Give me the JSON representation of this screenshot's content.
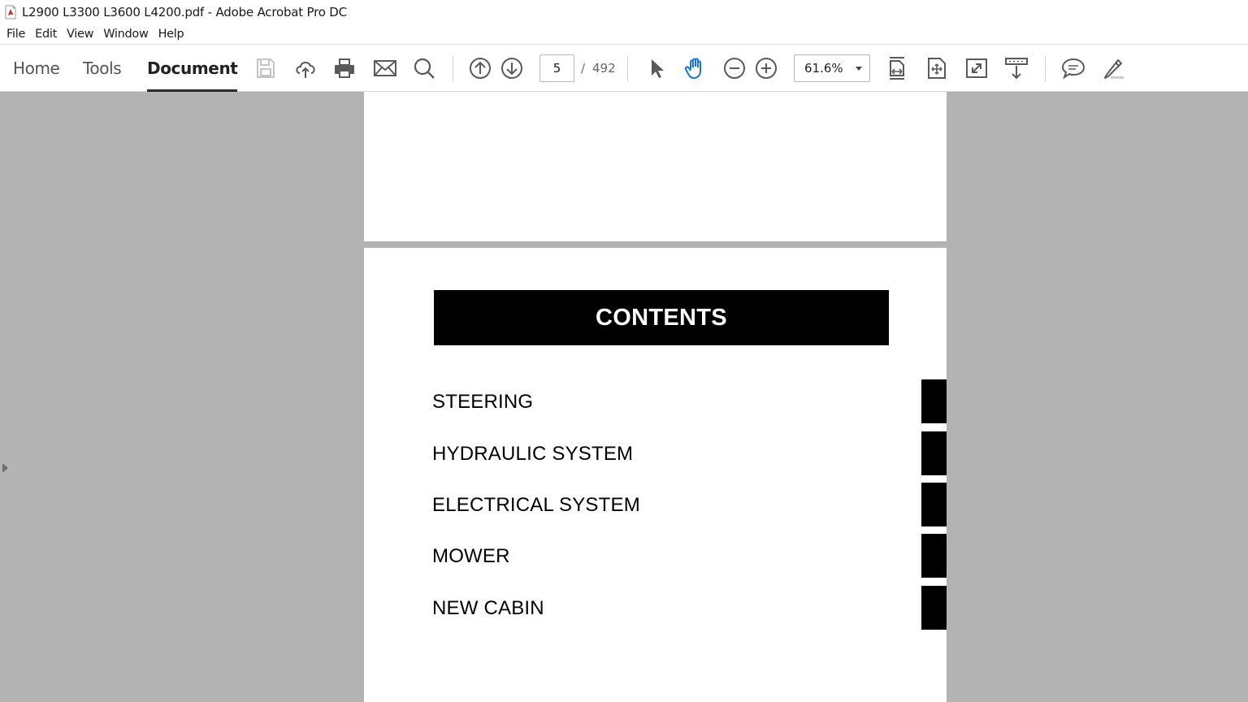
{
  "window": {
    "title": "L2900 L3300 L3600 L4200.pdf - Adobe Acrobat Pro DC"
  },
  "menu": {
    "items": [
      "File",
      "Edit",
      "View",
      "Window",
      "Help"
    ]
  },
  "toolbar": {
    "tabs": [
      {
        "label": "Home",
        "active": false
      },
      {
        "label": "Tools",
        "active": false
      },
      {
        "label": "Document",
        "active": true
      }
    ],
    "page_current": "5",
    "page_separator": "/",
    "page_total": "492",
    "zoom": "61.6%",
    "icons": [
      "save-icon",
      "cloud-upload-icon",
      "print-icon",
      "email-icon",
      "search-icon",
      "previous-page-icon",
      "next-page-icon",
      "select-cursor-icon",
      "hand-tool-icon",
      "zoom-out-icon",
      "zoom-in-icon",
      "fit-width-icon",
      "fit-page-icon",
      "full-screen-icon",
      "scroll-mode-icon",
      "comment-icon",
      "highlight-pen-icon"
    ]
  },
  "document": {
    "heading": "CONTENTS",
    "toc": [
      "STEERING",
      "HYDRAULIC SYSTEM",
      "ELECTRICAL SYSTEM",
      "MOWER",
      "NEW CABIN"
    ]
  },
  "colors": {
    "viewer_background": "#b3b3b3",
    "page_background": "#ffffff",
    "banner": "#000000"
  }
}
